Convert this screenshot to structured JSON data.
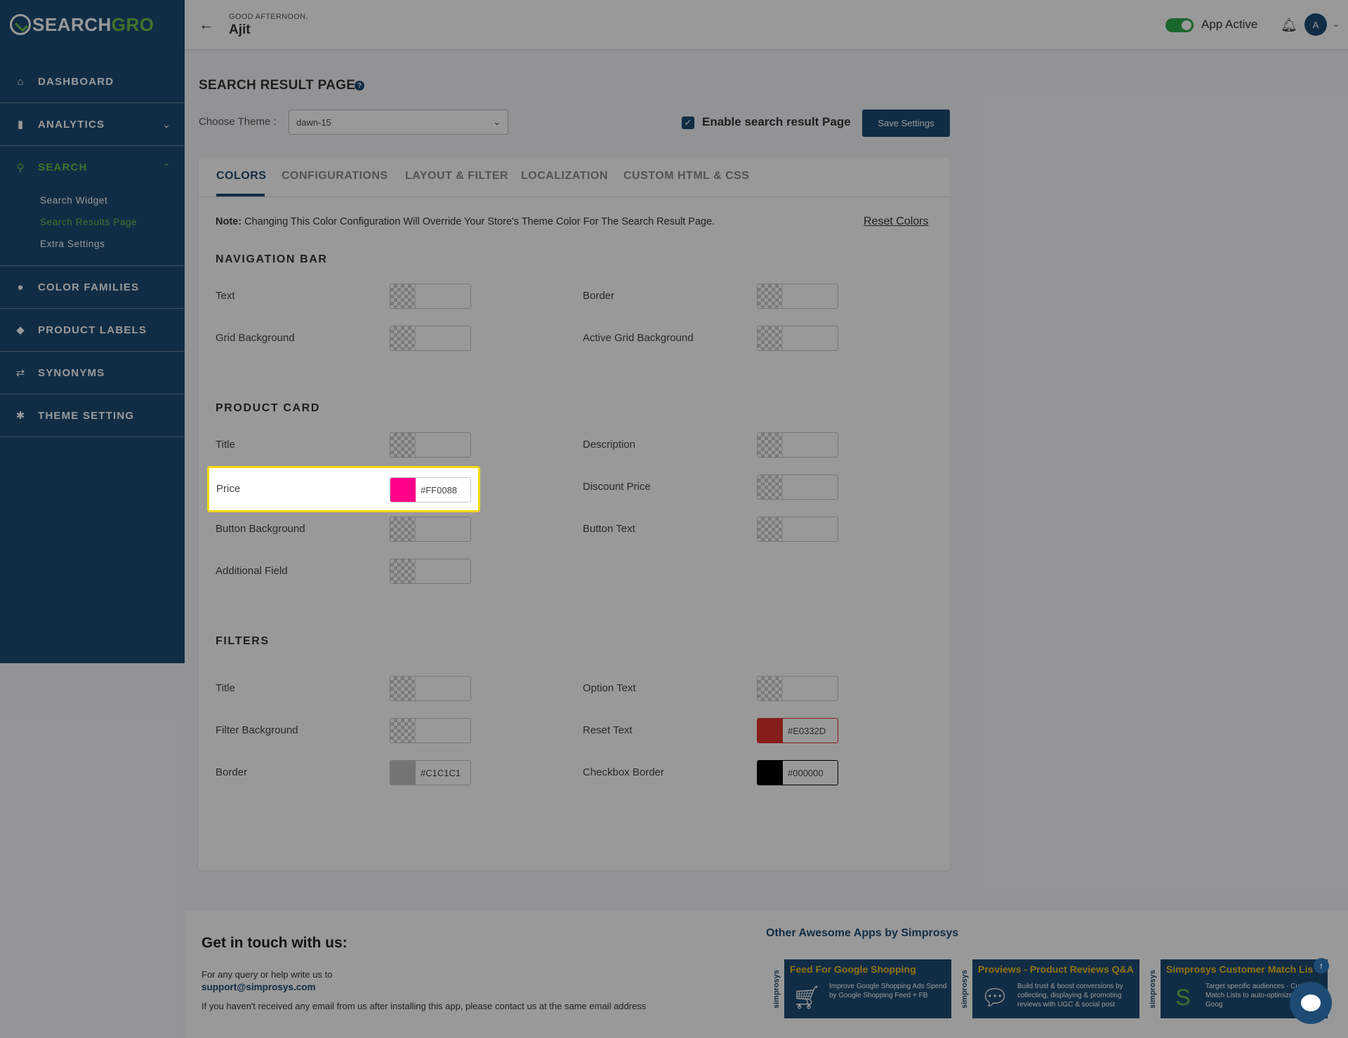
{
  "brand": {
    "name_part1": "SEARCH",
    "name_part2": "GRO"
  },
  "sidebar": {
    "items": [
      {
        "label": "DASHBOARD",
        "icon": "home-icon"
      },
      {
        "label": "ANALYTICS",
        "icon": "bar-chart-icon"
      },
      {
        "label": "SEARCH",
        "icon": "search-icon"
      },
      {
        "label": "COLOR FAMILIES",
        "icon": "palette-icon"
      },
      {
        "label": "PRODUCT LABELS",
        "icon": "tag-icon"
      },
      {
        "label": "SYNONYMS",
        "icon": "sync-icon"
      },
      {
        "label": "THEME SETTING",
        "icon": "gear-icon"
      }
    ],
    "search_sub": [
      "Search Widget",
      "Search Results Page",
      "Extra Settings"
    ]
  },
  "header": {
    "greeting": "GOOD AFTERNOON,",
    "user": "Ajit",
    "app_status": "App Active",
    "avatar_initial": "A"
  },
  "page": {
    "title": "SEARCH RESULT PAGE",
    "theme_label": "Choose Theme :",
    "theme_value": "dawn-15",
    "enable_label": "Enable search result Page",
    "save_label": "Save Settings"
  },
  "tabs": [
    "COLORS",
    "CONFIGURATIONS",
    "LAYOUT & FILTER",
    "LOCALIZATION",
    "CUSTOM HTML & CSS"
  ],
  "note": {
    "prefix": "Note:",
    "text": " Changing This Color Configuration Will Override Your Store's Theme Color For The Search Result Page.",
    "reset": "Reset Colors"
  },
  "sections": {
    "navigation_bar": {
      "title": "NAVIGATION BAR",
      "fields": {
        "text": "Text",
        "border": "Border",
        "grid_bg": "Grid Background",
        "active_grid_bg": "Active Grid Background"
      }
    },
    "product_card": {
      "title": "PRODUCT CARD",
      "fields": {
        "title": "Title",
        "description": "Description",
        "price": "Price",
        "price_value": "#FF0088",
        "discount_price": "Discount Price",
        "button_bg": "Button Background",
        "button_text": "Button Text",
        "additional_field": "Additional Field"
      }
    },
    "filters": {
      "title": "FILTERS",
      "fields": {
        "title": "Title",
        "option_text": "Option Text",
        "filter_bg": "Filter Background",
        "reset_text": "Reset Text",
        "reset_text_value": "#E0332D",
        "border": "Border",
        "border_value": "#C1C1C1",
        "checkbox_border": "Checkbox Border",
        "checkbox_border_value": "#000000"
      }
    }
  },
  "colors": {
    "price": "#FF0088",
    "reset_text": "#E0332D",
    "border": "#C1C1C1",
    "checkbox_border": "#000000",
    "brand": "#1d4b73",
    "accent": "#6cc24a"
  },
  "footer": {
    "title": "Get in touch with us:",
    "line1": "For any query or help write us to",
    "email": "support@simprosys.com",
    "line2": "If you haven't received any email from us after installing this app, please contact us at the same email address",
    "apps_title": "Other Awesome Apps by Simprosys",
    "apps": [
      {
        "side": "simprosys",
        "title": "Feed For Google Shopping",
        "desc": "Improve Google Shopping Ads Spend by Google Shopping Feed + FB",
        "icon": "cart-icon"
      },
      {
        "side": "simprosys",
        "title": "Proviews - Product Reviews Q&A",
        "desc": "Build trust & boost conversions by collecting, displaying & promoting reviews with UGC & social post",
        "icon": "chat-bubble-icon"
      },
      {
        "side": "simprosys",
        "title": "Simprosys Customer Match Lis",
        "desc": "Target specific audiences · Customer Match Lists to auto-optimize your Goog",
        "icon": "s-logo-icon"
      }
    ]
  }
}
